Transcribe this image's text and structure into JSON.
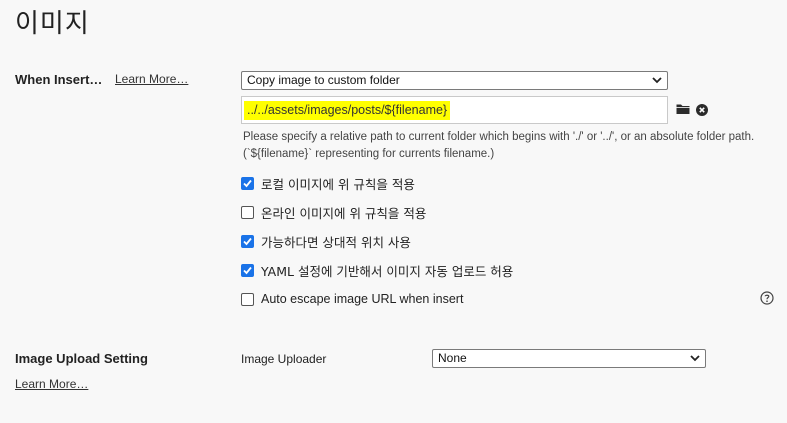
{
  "title": "이미지",
  "insert": {
    "label": "When Insert…",
    "learn_more": "Learn More…",
    "action_select": "Copy image to custom folder",
    "path_value": "../../assets/images/posts/${filename}",
    "help": " Please specify a relative path to current folder which begins with './' or '../', or an absolute folder path. (`${filename}` representing for currents filename.)",
    "folder_icon": "folder-icon",
    "clear_icon": "clear-icon"
  },
  "options": [
    {
      "label": "로컬 이미지에 위 규칙을 적용",
      "checked": true
    },
    {
      "label": "온라인 이미지에 위 규칙을 적용",
      "checked": false
    },
    {
      "label": "가능하다면 상대적 위치 사용",
      "checked": true
    },
    {
      "label": "YAML 설정에 기반해서 이미지 자동 업로드 허용",
      "checked": true
    },
    {
      "label": "Auto escape image URL when insert",
      "checked": false
    }
  ],
  "upload": {
    "label": "Image Upload Setting",
    "learn_more": "Learn More…",
    "uploader_label": "Image Uploader",
    "uploader_value": "None"
  },
  "colors": {
    "accent": "#1a73e8",
    "highlight": "#ffff00"
  }
}
